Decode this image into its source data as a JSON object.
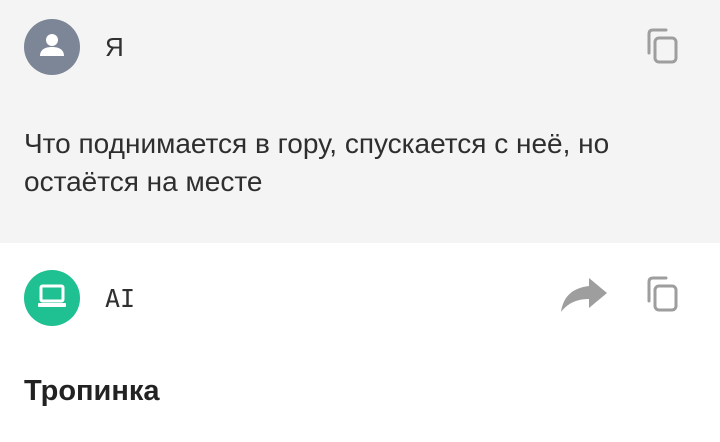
{
  "user_message": {
    "sender": "Я",
    "text": "Что поднимается в гору, спускается с неё, но остаётся на месте",
    "avatar_icon": "person-icon",
    "avatar_color": "#7d8696",
    "background": "#f4f4f4",
    "actions": [
      "copy-icon"
    ]
  },
  "ai_message": {
    "sender": "AI",
    "text": "Тропинка",
    "avatar_icon": "laptop-icon",
    "avatar_color": "#1fc091",
    "actions": [
      "share-icon",
      "copy-icon"
    ]
  }
}
